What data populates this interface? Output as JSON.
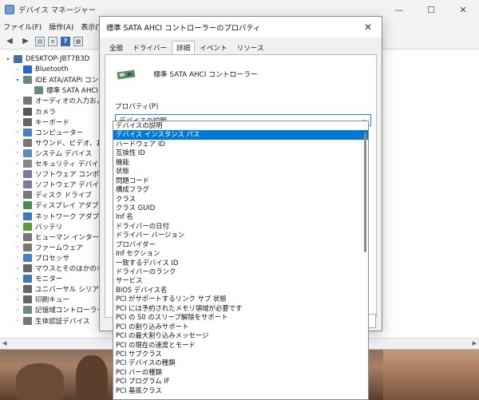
{
  "device_manager": {
    "title": "デバイス マネージャー",
    "menu": [
      "ファイル(F)",
      "操作(A)",
      "表示(V)"
    ],
    "window_buttons": {
      "minimize": "—",
      "maximize": "☐",
      "close": "✕"
    },
    "tree": [
      {
        "label": "DESKTOP-JBT7B3D",
        "level": 0,
        "expander": "▾",
        "icon": "computer-icon",
        "color": "#4a6fa5"
      },
      {
        "label": "Bluetooth",
        "level": 1,
        "expander": "›",
        "icon": "bluetooth-icon",
        "color": "#2a64c8"
      },
      {
        "label": "IDE ATA/ATAPI コントローラー",
        "level": 1,
        "expander": "▾",
        "icon": "controller-icon",
        "color": "#6a8a7a"
      },
      {
        "label": "標準 SATA AHCI コントローラー",
        "level": 2,
        "expander": "",
        "icon": "controller-icon",
        "color": "#6a8a7a"
      },
      {
        "label": "オーディオの入力および出力",
        "level": 1,
        "expander": "›",
        "icon": "audio-icon",
        "color": "#777"
      },
      {
        "label": "カメラ",
        "level": 1,
        "expander": "›",
        "icon": "camera-icon",
        "color": "#555"
      },
      {
        "label": "キーボード",
        "level": 1,
        "expander": "›",
        "icon": "keyboard-icon",
        "color": "#666"
      },
      {
        "label": "コンピューター",
        "level": 1,
        "expander": "›",
        "icon": "computer-icon",
        "color": "#4a7fc0"
      },
      {
        "label": "サウンド、ビデオ、およびゲーム コントローラー",
        "level": 1,
        "expander": "›",
        "icon": "sound-icon",
        "color": "#777"
      },
      {
        "label": "システム デバイス",
        "level": 1,
        "expander": "›",
        "icon": "system-icon",
        "color": "#5a8ac0"
      },
      {
        "label": "セキュリティ デバイス",
        "level": 1,
        "expander": "›",
        "icon": "security-icon",
        "color": "#888"
      },
      {
        "label": "ソフトウェア コンポーネント",
        "level": 1,
        "expander": "›",
        "icon": "software-icon",
        "color": "#7a7a9a"
      },
      {
        "label": "ソフトウェア デバイス",
        "level": 1,
        "expander": "›",
        "icon": "software-icon",
        "color": "#7a7a9a"
      },
      {
        "label": "ディスク ドライブ",
        "level": 1,
        "expander": "›",
        "icon": "disk-icon",
        "color": "#777"
      },
      {
        "label": "ディスプレイ アダプター",
        "level": 1,
        "expander": "›",
        "icon": "display-icon",
        "color": "#4a8a5a"
      },
      {
        "label": "ネットワーク アダプター",
        "level": 1,
        "expander": "›",
        "icon": "network-icon",
        "color": "#3a7ab0"
      },
      {
        "label": "バッテリ",
        "level": 1,
        "expander": "›",
        "icon": "battery-icon",
        "color": "#5a9a3a"
      },
      {
        "label": "ヒューマン インターフェイス デバイス",
        "level": 1,
        "expander": "›",
        "icon": "hid-icon",
        "color": "#777"
      },
      {
        "label": "ファームウェア",
        "level": 1,
        "expander": "›",
        "icon": "firmware-icon",
        "color": "#777"
      },
      {
        "label": "プロセッサ",
        "level": 1,
        "expander": "›",
        "icon": "processor-icon",
        "color": "#4a7fc0"
      },
      {
        "label": "マウスとそのほかのポインティング デバイス",
        "level": 1,
        "expander": "›",
        "icon": "mouse-icon",
        "color": "#666"
      },
      {
        "label": "モニター",
        "level": 1,
        "expander": "›",
        "icon": "monitor-icon",
        "color": "#3a7ab0"
      },
      {
        "label": "ユニバーサル シリアル バス コントローラー",
        "level": 1,
        "expander": "›",
        "icon": "usb-icon",
        "color": "#666"
      },
      {
        "label": "印刷キュー",
        "level": 1,
        "expander": "›",
        "icon": "printer-icon",
        "color": "#666"
      },
      {
        "label": "記憶域コントローラー",
        "level": 1,
        "expander": "›",
        "icon": "storage-icon",
        "color": "#6a8a7a"
      },
      {
        "label": "生体認証デバイス",
        "level": 1,
        "expander": "›",
        "icon": "biometric-icon",
        "color": "#777"
      }
    ]
  },
  "dialog": {
    "title": "標準 SATA AHCI コントローラーのプロパティ",
    "close": "✕",
    "tabs": [
      "全般",
      "ドライバー",
      "詳細",
      "イベント",
      "リソース"
    ],
    "active_tab": "詳細",
    "device_name": "標準 SATA AHCI コントローラー",
    "property_label": "プロパティ(P)",
    "selected_property": "デバイスの説明",
    "chevron": "⌄",
    "options": [
      "デバイスの説明",
      "デバイス インスタンス パス",
      "ハードウェア ID",
      "互換性 ID",
      "機能",
      "状態",
      "問題コード",
      "構成フラグ",
      "クラス",
      "クラス GUID",
      "Inf 名",
      "ドライバーの日付",
      "ドライバー バージョン",
      "プロバイダー",
      "Inf セクション",
      "一致するデバイス ID",
      "ドライバーのランク",
      "サービス",
      "BIOS デバイス名",
      "PCI がサポートするリンク サブ 状態",
      "PCI には予約されたメモリ領域が必要です",
      "PCI の S0 のスリープ解除をサポート",
      "PCI の割り込みサポート",
      "PCI の最大割り込みメッセージ",
      "PCI の現在の速度とモード",
      "PCI サブクラス",
      "PCI デバイスの種類",
      "PCI バーの種類",
      "PCI プログラム IF",
      "PCI 基底クラス"
    ],
    "highlighted_index": 1
  }
}
